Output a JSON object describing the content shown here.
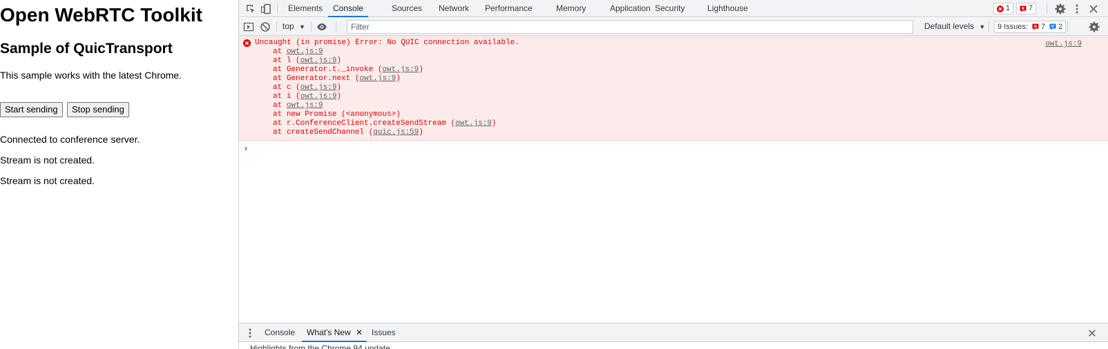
{
  "page": {
    "title": "Open WebRTC Toolkit",
    "subtitle": "Sample of QuicTransport",
    "description": "This sample works with the latest Chrome.",
    "start_button": "Start sending",
    "stop_button": "Stop sending",
    "status_lines": [
      "Connected to conference server.",
      "Stream is not created.",
      "Stream is not created."
    ]
  },
  "devtools": {
    "tabs": [
      {
        "label": "Elements",
        "active": false
      },
      {
        "label": "Console",
        "active": true
      },
      {
        "label": "Sources",
        "active": false
      },
      {
        "label": "Network",
        "active": false
      },
      {
        "label": "Performance",
        "active": false
      },
      {
        "label": "Memory",
        "active": false
      },
      {
        "label": "Application",
        "active": false
      },
      {
        "label": "Security",
        "active": false
      },
      {
        "label": "Lighthouse",
        "active": false
      }
    ],
    "error_count": "1",
    "warning_count": "7",
    "toolbar": {
      "context": "top",
      "filter_placeholder": "Filter",
      "levels": "Default levels",
      "issues_label": "9 Issues:",
      "issues_errors": "7",
      "issues_info": "2"
    },
    "error": {
      "message": "Uncaught (in promise) Error: No QUIC connection available.",
      "source": "owt.js:9",
      "stack": [
        {
          "prefix": "at ",
          "fn": "",
          "link": "owt.js:9"
        },
        {
          "prefix": "at ",
          "fn": "l",
          "link": "owt.js:9"
        },
        {
          "prefix": "at ",
          "fn": "Generator.t._invoke",
          "link": "owt.js:9"
        },
        {
          "prefix": "at ",
          "fn": "Generator.next",
          "link": "owt.js:9"
        },
        {
          "prefix": "at ",
          "fn": "c",
          "link": "owt.js:9"
        },
        {
          "prefix": "at ",
          "fn": "i",
          "link": "owt.js:9"
        },
        {
          "prefix": "at ",
          "fn": "",
          "link": "owt.js:9"
        },
        {
          "prefix": "at ",
          "fn": "new Promise",
          "link": "<anonymous>",
          "plain": true
        },
        {
          "prefix": "at ",
          "fn": "r.ConferenceClient.createSendStream",
          "link": "owt.js:9"
        },
        {
          "prefix": "at ",
          "fn": "createSendChannel",
          "link": "quic.js:59"
        }
      ]
    },
    "prompt": "›",
    "drawer": {
      "tabs": [
        {
          "label": "Console",
          "active": false
        },
        {
          "label": "What's New",
          "active": true,
          "closable": true
        },
        {
          "label": "Issues",
          "active": false
        }
      ],
      "content": "Highlights from the Chrome 94 update"
    },
    "colors": {
      "accent": "#1a73e8",
      "error": "#e00000",
      "error_bg": "#fcebeb"
    }
  }
}
